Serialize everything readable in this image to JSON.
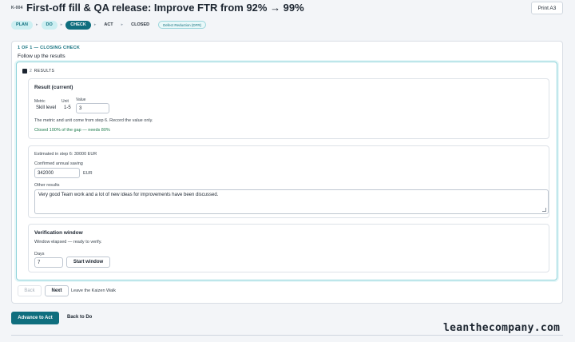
{
  "header": {
    "kaizen_id": "K-004",
    "title": "First-off fill & QA release: Improve FTR from 92% → 99%",
    "print_label": "Print A3"
  },
  "phases": [
    {
      "label": "PLAN",
      "state": "done"
    },
    {
      "label": "DO",
      "state": "done"
    },
    {
      "label": "CHECK",
      "state": "active"
    },
    {
      "label": "ACT",
      "state": "todo"
    },
    {
      "label": "CLOSED",
      "state": "todo"
    }
  ],
  "phase_tag": "Defect Reduction (DFR)",
  "step": {
    "label": "1 OF 1 — CLOSING CHECK",
    "subtitle": "Follow up the results"
  },
  "results": {
    "number": "2",
    "title": "RESULTS",
    "current": {
      "title": "Result (current)",
      "metric_label": "Metric",
      "unit_label": "Unit",
      "value_label": "Value",
      "metric": "Skill level",
      "unit": "1-5",
      "value": "3",
      "note": "The metric and unit come from step 6. Record the value only.",
      "gap_status": "Closed 100% of the gap — needs 80%"
    },
    "saving": {
      "estimated": "Estimated in step 6: 30000 EUR",
      "confirmed_label": "Confirmed annual saving",
      "confirmed_value": "342000",
      "currency": "EUR",
      "other_label": "Other results",
      "other_value": "Very good Team work and a lot of new ideas for improvements have been discussed."
    },
    "verification": {
      "title": "Verification window",
      "status": "Window elapsed — ready to verify.",
      "days_label": "Days",
      "days_value": "7",
      "start_label": "Start window"
    }
  },
  "nav": {
    "back_label": "Back",
    "next_label": "Next",
    "leave_label": "Leave the Kaizen Walk"
  },
  "footer": {
    "advance_label": "Advance to Act",
    "back_do_label": "Back to Do",
    "watermark": "leanthecompany.com"
  },
  "colors": {
    "accent": "#0f6e7e",
    "success": "#1e7a4c",
    "highlight_border": "#8ed3da"
  }
}
